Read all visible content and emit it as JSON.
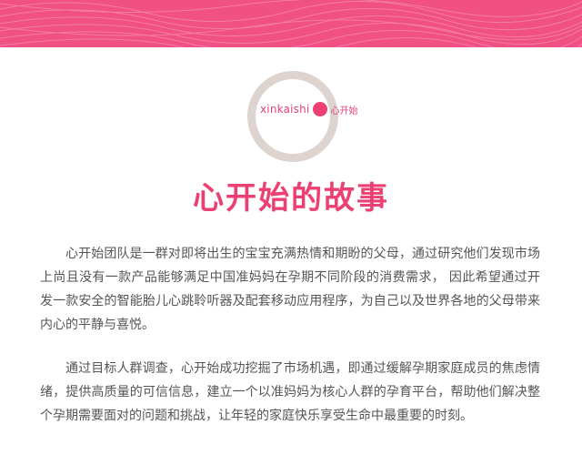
{
  "banner": {
    "color": "#f05082"
  },
  "logo": {
    "en": "xinkaishi",
    "cn": "心开始",
    "ring_color": "#ddd4d0",
    "dot_color": "#ec3f72"
  },
  "title": "心开始的故事",
  "paragraphs": [
    "心开始团队是一群对即将出生的宝宝充满热情和期盼的父母，通过研究他们发现市场上尚且没有一款产品能够满足中国准妈妈在孕期不同阶段的消费需求， 因此希望通过开发一款安全的智能胎儿心跳聆听器及配套移动应用程序，为自己以及世界各地的父母带来内心的平静与喜悦。",
    "通过目标人群调查，心开始成功挖掘了市场机遇，即通过缓解孕期家庭成员的焦虑情绪，提供高质量的可信信息，建立一个以准妈妈为核心人群的孕育平台，帮助他们解决整个孕期需要面对的问题和挑战，让年轻的家庭快乐享受生命中最重要的时刻。"
  ]
}
